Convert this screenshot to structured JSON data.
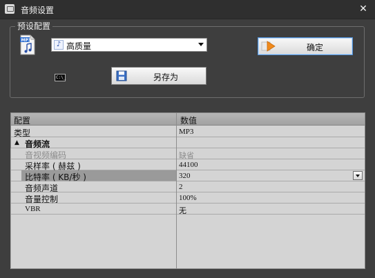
{
  "window": {
    "title": "音频设置",
    "close_glyph": "✕"
  },
  "preset": {
    "group_label": "预设配置",
    "selected": "高质量",
    "ok_label": "确定",
    "save_as_label": "另存为",
    "cmd_icon_text": "C:\\_"
  },
  "grid": {
    "headers": {
      "config": "配置",
      "value": "数值"
    },
    "rows": [
      {
        "label": "类型",
        "value": "MP3"
      },
      {
        "label": "音频流",
        "value": ""
      },
      {
        "label": "音视频编码",
        "value": "缺省"
      },
      {
        "label": "采样率 ( 赫兹 )",
        "value": "44100"
      },
      {
        "label": "比特率 ( KB/秒 )",
        "value": "320"
      },
      {
        "label": "音频声道",
        "value": "2"
      },
      {
        "label": "音量控制",
        "value": "100%"
      },
      {
        "label": "VBR",
        "value": "无"
      }
    ],
    "section_toggle": "▲"
  },
  "colors": {
    "window_bg": "#3e3e3e",
    "grid_bg": "#d4d4d4",
    "header_bg": "#a9a9a9",
    "selected_cell": "#9a9a9a",
    "ok_border": "#4f90d8"
  }
}
